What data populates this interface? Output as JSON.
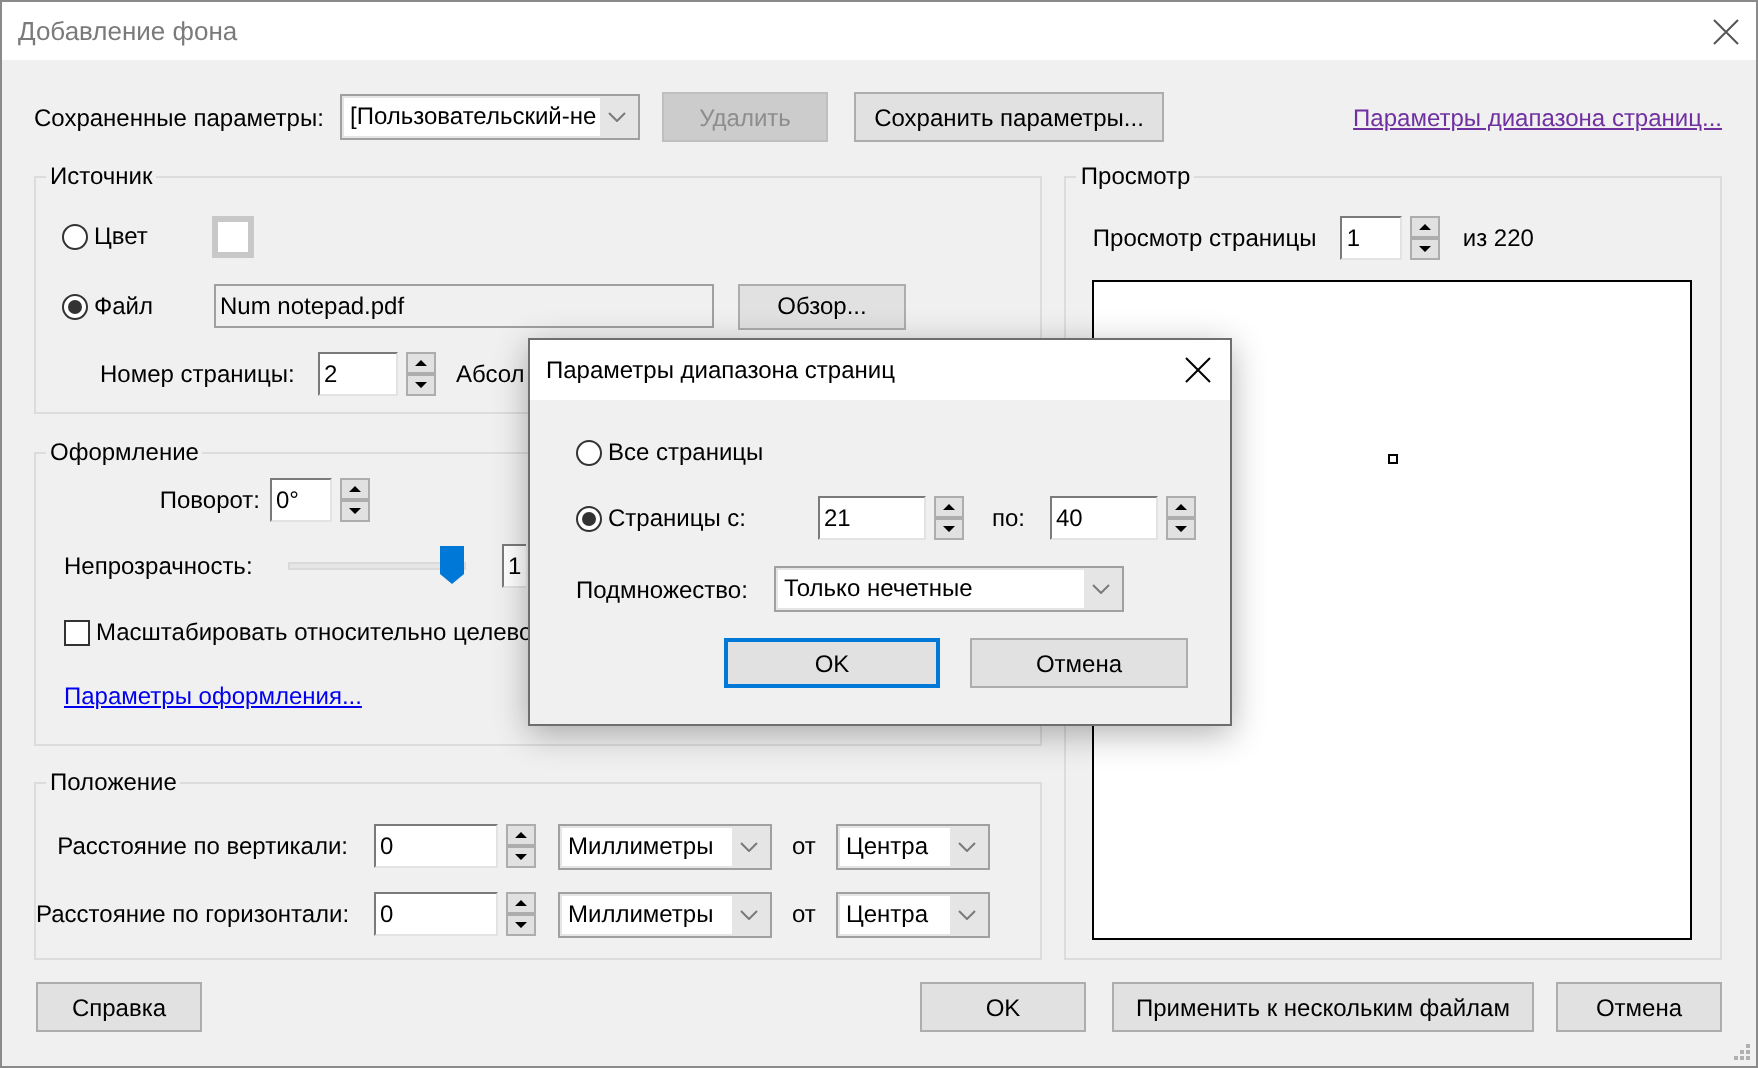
{
  "window": {
    "title": "Добавление фона"
  },
  "saved_settings": {
    "label": "Сохраненные параметры:",
    "value": "[Пользовательский-не",
    "delete_button": {
      "label": "Удалить",
      "disabled": true
    },
    "save_button": "Сохранить параметры..."
  },
  "page_range_link": "Параметры диапазона страниц...",
  "source": {
    "title": "Источник",
    "options": [
      {
        "kind": "color",
        "label": "Цвет",
        "selected": false
      },
      {
        "kind": "file",
        "label": "Файл",
        "selected": true,
        "value": "Num notepad.pdf",
        "button": "Обзор..."
      }
    ],
    "page_number": {
      "label": "Номер страницы:",
      "value": "2"
    },
    "absolute_label": "Абсол"
  },
  "appearance": {
    "title": "Оформление",
    "rotation": {
      "label": "Поворот:",
      "value": "0°"
    },
    "opacity": {
      "label": "Непрозрачность:",
      "level": 0.93,
      "value": "1"
    },
    "scale": {
      "label": "Масштабировать относительно целево",
      "checked": false
    },
    "link": "Параметры оформления..."
  },
  "position": {
    "title": "Положение",
    "rows": [
      {
        "label": "Расстояние по вертикали:",
        "value": "0",
        "unit": "Миллиметры",
        "from_label": "от",
        "anchor": "Центра"
      },
      {
        "label": "Расстояние по горизонтали:",
        "value": "0",
        "unit": "Миллиметры",
        "from_label": "от",
        "anchor": "Центра"
      }
    ]
  },
  "preview": {
    "title": "Просмотр",
    "page_label": "Просмотр страницы",
    "page": "1",
    "total": "из 220"
  },
  "buttons": [
    {
      "label": "Справка"
    },
    {
      "label": "OK"
    },
    {
      "label": "Применить к нескольким файлам"
    },
    {
      "label": "Отмена"
    }
  ],
  "range_dialog": {
    "title": "Параметры диапазона страниц",
    "options": [
      {
        "label": "Все страницы",
        "selected": false
      },
      {
        "label": "Страницы с:",
        "selected": true
      }
    ],
    "from": "21",
    "to_label": "по:",
    "to": "40",
    "subset": {
      "label": "Подмножество:",
      "value": "Только нечетные"
    },
    "buttons": [
      {
        "label": "OK",
        "focused": true
      },
      {
        "label": "Отмена",
        "focused": false
      }
    ]
  }
}
